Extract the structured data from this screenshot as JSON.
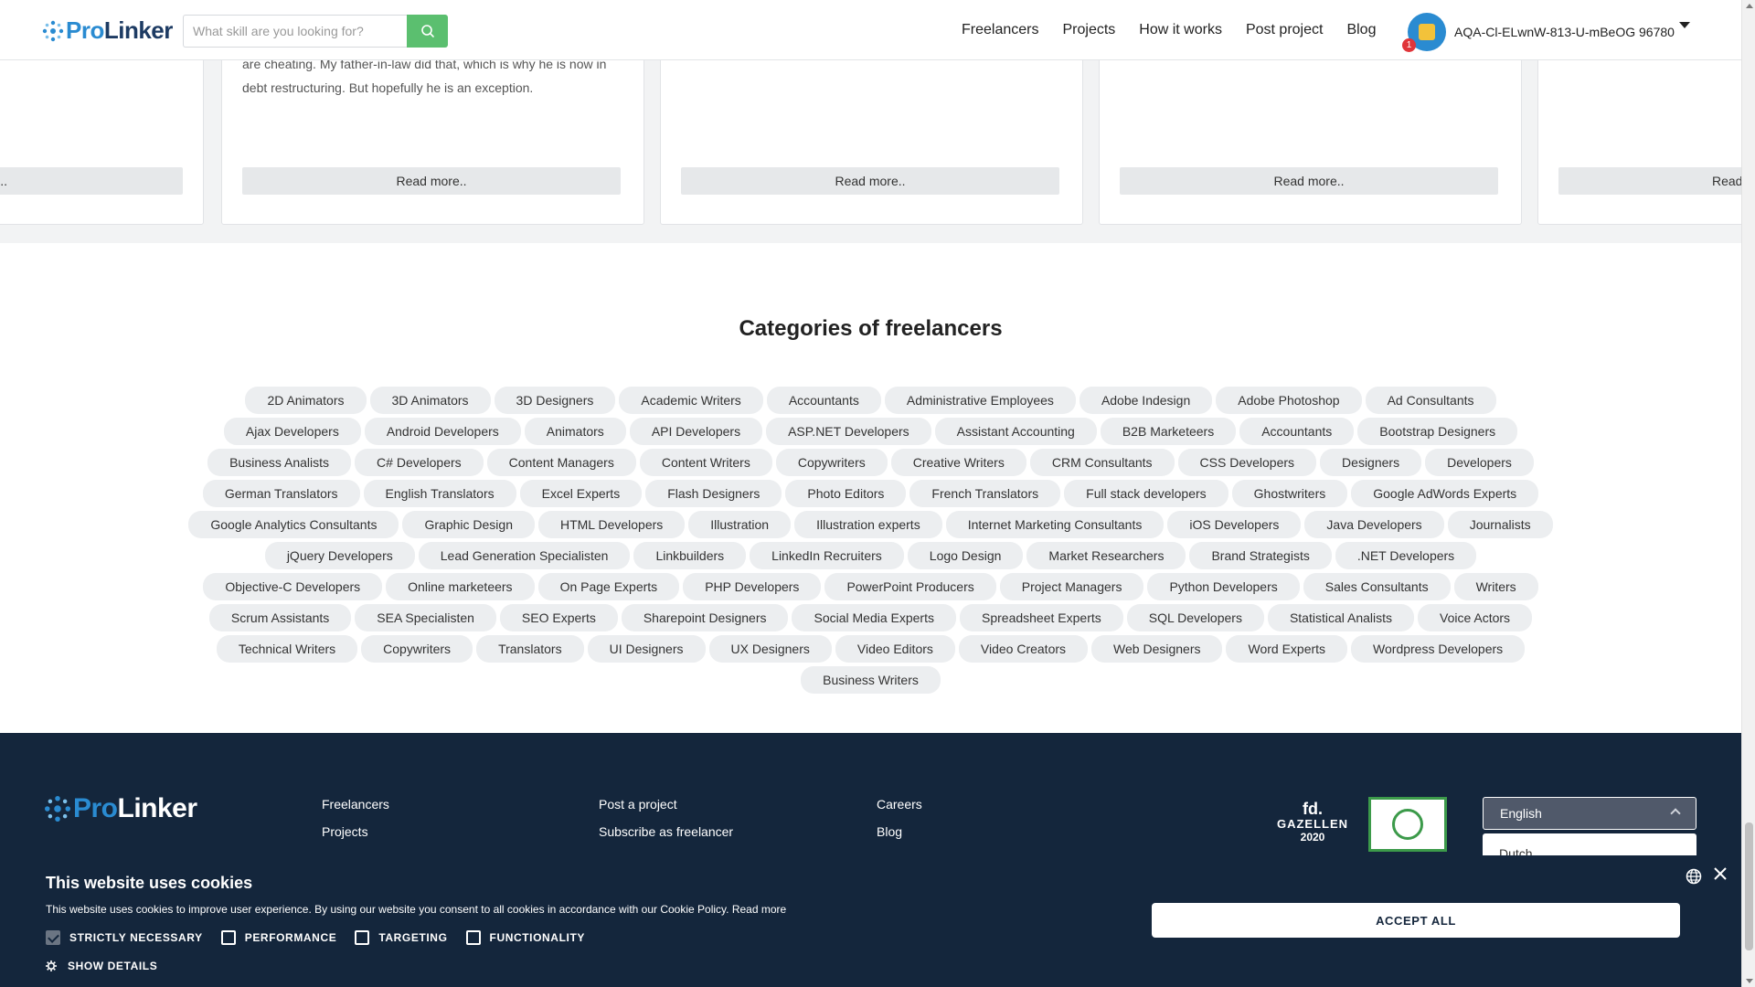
{
  "header": {
    "logo_pro": "Pro",
    "logo_linker": "Linker",
    "search_placeholder": "What skill are you looking for?",
    "nav": [
      "Freelancers",
      "Projects",
      "How it works",
      "Post project",
      "Blog"
    ],
    "user_name": "AQA-Cl-ELwnW-813-U-mBeOG 96780",
    "notification_count": "1"
  },
  "reviews": {
    "card2_text": "are cheating. My father-in-law did that, which is why he is now in debt restructuring. But hopefully he is an exception.",
    "read_more_label": "Read more..",
    "read_more_partial_left": "ore..",
    "read_more_partial_right": "Read"
  },
  "categories": {
    "title": "Categories of freelancers",
    "tags": [
      "2D Animators",
      "3D Animators",
      "3D Designers",
      "Academic Writers",
      "Accountants",
      "Administrative Employees",
      "Adobe Indesign",
      "Adobe Photoshop",
      "Ad Consultants",
      "Ajax Developers",
      "Android Developers",
      "Animators",
      "API Developers",
      "ASP.NET Developers",
      "Assistant Accounting",
      "B2B Marketeers",
      "Accountants",
      "Bootstrap Designers",
      "Business Analists",
      "C# Developers",
      "Content Managers",
      "Content Writers",
      "Copywriters",
      "Creative Writers",
      "CRM Consultants",
      "CSS Developers",
      "Designers",
      "Developers",
      "German Translators",
      "English Translators",
      "Excel Experts",
      "Flash Designers",
      "Photo Editors",
      "French Translators",
      "Full stack developers",
      "Ghostwriters",
      "Google AdWords Experts",
      "Google Analytics Consultants",
      "Graphic Design",
      "HTML Developers",
      "Illustration",
      "Illustration experts",
      "Internet Marketing Consultants",
      "iOS Developers",
      "Java Developers",
      "Journalists",
      "jQuery Developers",
      "Lead Generation Specialisten",
      "Linkbuilders",
      "LinkedIn Recruiters",
      "Logo Design",
      "Market Researchers",
      "Brand Strategists",
      ".NET Developers",
      "Objective-C Developers",
      "Online marketeers",
      "On Page Experts",
      "PHP Developers",
      "PowerPoint Producers",
      "Project Managers",
      "Python Developers",
      "Sales Consultants",
      "Writers",
      "Scrum Assistants",
      "SEA Specialisten",
      "SEO Experts",
      "Sharepoint Designers",
      "Social Media Experts",
      "Spreadsheet Experts",
      "SQL Developers",
      "Statistical Analists",
      "Voice Actors",
      "Technical Writers",
      "Copywriters",
      "Translators",
      "UI Designers",
      "UX Designers",
      "Video Editors",
      "Video Creators",
      "Web Designers",
      "Word Experts",
      "Wordpress Developers",
      "Business Writers"
    ]
  },
  "footer": {
    "col1": [
      "Freelancers",
      "Projects"
    ],
    "col2": [
      "Post a project",
      "Subscribe as freelancer"
    ],
    "col3": [
      "Careers",
      "Blog"
    ],
    "badge_fd": "fd.",
    "badge_gazellen": "GAZELLEN",
    "badge_year": "2020",
    "language_selected": "English",
    "language_option": "Dutch"
  },
  "cookie": {
    "title": "This website uses cookies",
    "description": "This website uses cookies to improve user experience. By using our website you consent to all cookies in accordance with our Cookie Policy. Read more",
    "options": [
      "STRICTLY NECESSARY",
      "PERFORMANCE",
      "TARGETING",
      "FUNCTIONALITY"
    ],
    "show_details": "SHOW DETAILS",
    "accept_all": "ACCEPT ALL"
  },
  "colors": {
    "brand_dark": "#14263c",
    "brand_blue": "#2a8bd1",
    "search_green": "#5bbf6f"
  }
}
